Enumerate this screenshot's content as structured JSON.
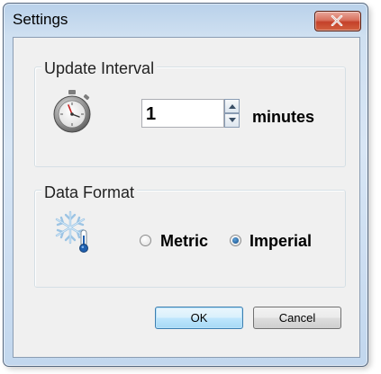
{
  "window": {
    "title": "Settings"
  },
  "update_interval": {
    "group_label": "Update Interval",
    "icon": "stopwatch-icon",
    "value": "1",
    "unit": "minutes"
  },
  "data_format": {
    "group_label": "Data Format",
    "icon": "snowflake-thermometer-icon",
    "options": [
      {
        "label": "Metric",
        "checked": false
      },
      {
        "label": "Imperial",
        "checked": true
      }
    ]
  },
  "buttons": {
    "ok": "OK",
    "cancel": "Cancel"
  },
  "colors": {
    "accent": "#3c7fb1",
    "close_red": "#c4412a",
    "frame": "#c2d7ee"
  }
}
